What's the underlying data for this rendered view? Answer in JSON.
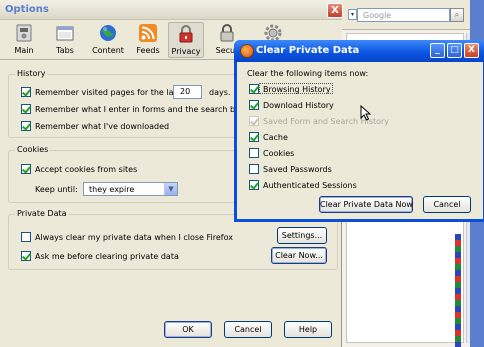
{
  "options": {
    "title": "Options",
    "close": "X",
    "tabs": [
      {
        "label": "Main",
        "icon": "main-switch-icon"
      },
      {
        "label": "Tabs",
        "icon": "tabs-window-icon"
      },
      {
        "label": "Content",
        "icon": "globe-icon"
      },
      {
        "label": "Feeds",
        "icon": "rss-feed-icon"
      },
      {
        "label": "Privacy",
        "icon": "privacy-mask-icon"
      },
      {
        "label": "Secur",
        "icon": "security-lock-icon"
      },
      {
        "label": "",
        "icon": "gear-icon"
      }
    ],
    "history": {
      "title": "History",
      "remember_visited": "Remember visited pages for the last",
      "days_value": "20",
      "days_label": "days.",
      "remember_forms": "Remember what I enter in forms and the search bar",
      "remember_downloads": "Remember what I've downloaded"
    },
    "cookies": {
      "title": "Cookies",
      "accept": "Accept cookies from sites",
      "keep_until_label": "Keep until:",
      "keep_until_value": "they expire"
    },
    "private_data": {
      "title": "Private Data",
      "always_clear": "Always clear my private data when I close Firefox",
      "settings_button": "Settings...",
      "ask_before": "Ask me before clearing private data",
      "clear_now_button": "Clear Now..."
    },
    "buttons": {
      "ok": "OK",
      "cancel": "Cancel",
      "help": "Help"
    }
  },
  "clear_dialog": {
    "title": "Clear Private Data",
    "heading": "Clear the following items now:",
    "items": [
      {
        "label": "Browsing History",
        "checked": true,
        "disabled": false
      },
      {
        "label": "Download History",
        "checked": true,
        "disabled": false
      },
      {
        "label": "Saved Form and Search History",
        "checked": true,
        "disabled": true
      },
      {
        "label": "Cache",
        "checked": true,
        "disabled": false
      },
      {
        "label": "Cookies",
        "checked": false,
        "disabled": false
      },
      {
        "label": "Saved Passwords",
        "checked": false,
        "disabled": false
      },
      {
        "label": "Authenticated Sessions",
        "checked": true,
        "disabled": false
      }
    ],
    "clear_now_button": "Clear Private Data Now",
    "cancel_button": "Cancel"
  },
  "browser": {
    "search_placeholder": "Google"
  }
}
